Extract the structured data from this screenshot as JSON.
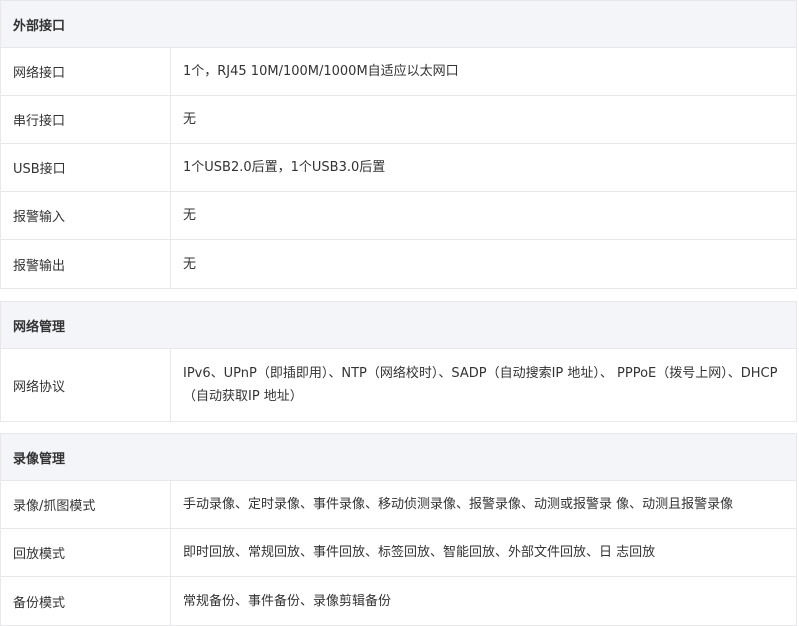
{
  "sections": [
    {
      "title": "外部接口",
      "rows": [
        {
          "label": "网络接口",
          "value": "1个，RJ45 10M/100M/1000M自适应以太网口"
        },
        {
          "label": "串行接口",
          "value": "无"
        },
        {
          "label": "USB接口",
          "value": "1个USB2.0后置，1个USB3.0后置"
        },
        {
          "label": "报警输入",
          "value": "无"
        },
        {
          "label": "报警输出",
          "value": "无"
        }
      ]
    },
    {
      "title": "网络管理",
      "rows": [
        {
          "label": "网络协议",
          "value": "IPv6、UPnP（即插即用）、NTP（网络校时）、SADP（自动搜索IP 地址）、 PPPoE（拨号上网）、DHCP（自动获取IP 地址）"
        }
      ]
    },
    {
      "title": "录像管理",
      "rows": [
        {
          "label": "录像/抓图模式",
          "value": "手动录像、定时录像、事件录像、移动侦测录像、报警录像、动测或报警录 像、动测且报警录像"
        },
        {
          "label": "回放模式",
          "value": "即时回放、常规回放、事件回放、标签回放、智能回放、外部文件回放、日 志回放"
        },
        {
          "label": "备份模式",
          "value": "常规备份、事件备份、录像剪辑备份"
        }
      ]
    }
  ]
}
